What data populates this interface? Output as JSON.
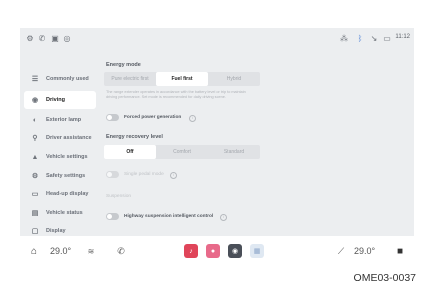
{
  "status_bar": {
    "time": "11:12"
  },
  "sidebar": {
    "items": [
      {
        "label": "Commonly used",
        "icon": "menu-icon"
      },
      {
        "label": "Driving",
        "icon": "steering-wheel-icon",
        "active": true
      },
      {
        "label": "Exterior lamp",
        "icon": "lamp-icon"
      },
      {
        "label": "Driver assistance",
        "icon": "driver-assist-icon"
      },
      {
        "label": "Vehicle settings",
        "icon": "car-icon"
      },
      {
        "label": "Safety settings",
        "icon": "safety-icon"
      },
      {
        "label": "Head-up display",
        "icon": "hud-icon"
      },
      {
        "label": "Vehicle status",
        "icon": "vehicle-status-icon"
      },
      {
        "label": "Display",
        "icon": "display-icon"
      }
    ]
  },
  "main": {
    "energy_mode": {
      "title": "Energy mode",
      "options": [
        "Pure electric first",
        "Fuel first",
        "Hybrid"
      ],
      "selected": "Fuel first",
      "description": "The range extender operates in accordance with the battery level or trip to maintain driving performance. Set mode is recommended for daily driving scene."
    },
    "forced_power_generation": {
      "label": "Forced power generation",
      "on": false
    },
    "energy_recovery": {
      "title": "Energy recovery level",
      "options": [
        "Off",
        "Comfort",
        "Standard"
      ],
      "selected": "Off"
    },
    "single_pedal": {
      "label": "Single pedal mode",
      "on": false
    },
    "suspension": {
      "title": "Suspension"
    },
    "highway_suspension": {
      "label": "Highway suspension intelligent control",
      "on": false
    }
  },
  "bottom_bar": {
    "left_temp": "29.0°",
    "right_temp": "29.0°"
  },
  "caption": "OME03-0037",
  "colors": {
    "screen_bg": "#eceef0",
    "accent_red": "#e0455a",
    "accent_pink": "#e86a8a"
  }
}
